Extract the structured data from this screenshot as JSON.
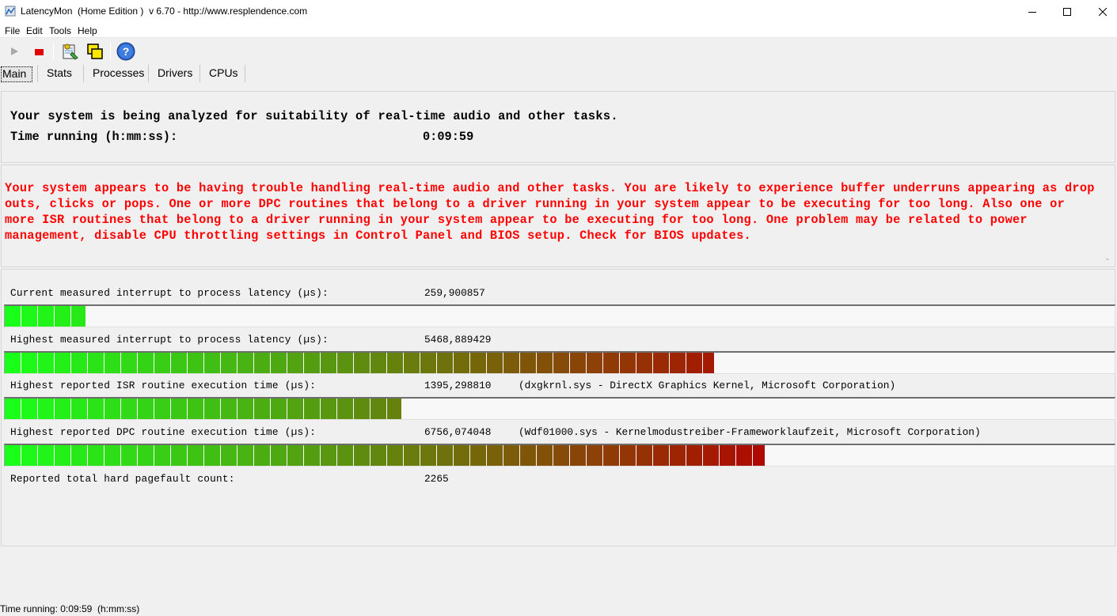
{
  "window": {
    "title": "LatencyMon  (Home Edition )  v 6.70 - http://www.resplendence.com",
    "minimize_glyph": "—",
    "maximize_glyph": "☐",
    "close_glyph": "✕"
  },
  "menu": [
    "File",
    "Edit",
    "Tools",
    "Help"
  ],
  "toolbar": {
    "items": [
      {
        "icon": "play-icon"
      },
      {
        "icon": "stop-icon"
      },
      {
        "icon": "report-icon"
      },
      {
        "icon": "windows-icon"
      },
      {
        "icon": "help-icon"
      }
    ]
  },
  "tabs": [
    "Main",
    "Stats",
    "Processes",
    "Drivers",
    "CPUs"
  ],
  "active_tab": "Main",
  "analysis": {
    "headline": "Your system is being analyzed for suitability of real-time audio and other tasks.",
    "time_label": "Time running (h:mm:ss):",
    "time_value": "0:09:59"
  },
  "warning": {
    "text": "Your system appears to be having trouble handling real-time audio and other tasks. You are likely to experience buffer underruns appearing as drop outs, clicks or pops. One or more DPC routines that belong to a driver running in your system appear to be executing for too long. Also one or more ISR routines that belong to a driver running in your system appear to be executing for too long. One problem may be related to power management, disable CPU throttling settings in Control Panel and BIOS setup. Check for BIOS updates.",
    "color": "#ff0000"
  },
  "measurements": [
    {
      "label": "Current measured interrupt to process latency (µs):",
      "value": "259,900857",
      "extra": "",
      "level": 0.073
    },
    {
      "label": "Highest measured interrupt to process latency (µs):",
      "value": "5468,889429",
      "extra": "",
      "level": 0.639
    },
    {
      "label": "Highest reported ISR routine execution time (µs):",
      "value": "1395,298810",
      "extra": "(dxgkrnl.sys - DirectX Graphics Kernel, Microsoft Corporation)",
      "level": 0.357
    },
    {
      "label": "Highest reported DPC routine execution time (µs):",
      "value": "6756,074048",
      "extra": "(Wdf01000.sys - Kernelmodustreiber-Frameworklaufzeit, Microsoft Corporation)",
      "level": 0.685
    }
  ],
  "pagefault": {
    "label": "Reported total hard pagefault count:",
    "value": "2265"
  },
  "status": {
    "text": "Time running: 0:09:59  (h:mm:ss)"
  },
  "colors": {
    "bar_start": "#1aff1a",
    "bar_end": "#b30000",
    "warning": "#ff0000"
  }
}
